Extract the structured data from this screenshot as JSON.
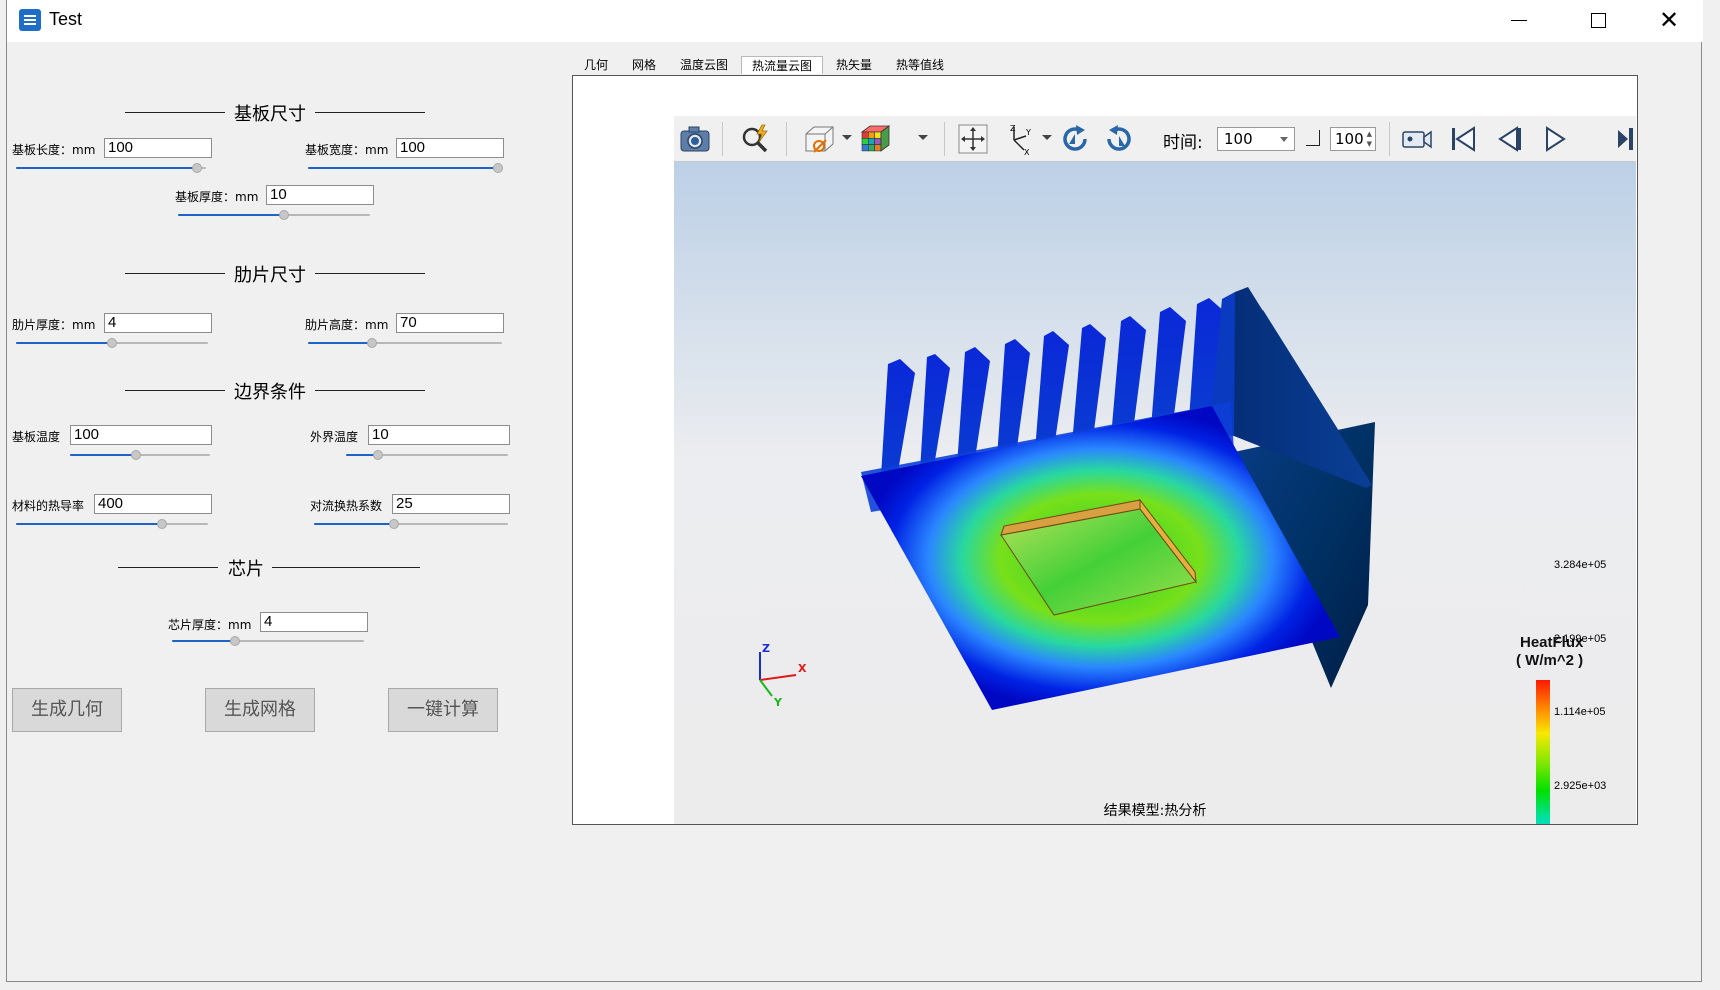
{
  "window": {
    "title": "Test",
    "close_glyph": "✕"
  },
  "sections": {
    "substrate": "基板尺寸",
    "fin": "肋片尺寸",
    "boundary": "边界条件",
    "chip": "芯片"
  },
  "fields": {
    "substrate_length": {
      "label": "基板长度：mm",
      "value": "100",
      "level": 0.95
    },
    "substrate_width": {
      "label": "基板宽度：mm",
      "value": "100",
      "level": 0.99
    },
    "substrate_thickness": {
      "label": "基板厚度：mm",
      "value": "10",
      "level": 0.55
    },
    "fin_thickness": {
      "label": "肋片厚度：mm",
      "value": "4",
      "level": 0.5
    },
    "fin_height": {
      "label": "肋片高度：mm",
      "value": "70",
      "level": 0.33
    },
    "substrate_temp": {
      "label": "基板温度",
      "value": "100",
      "level": 0.47
    },
    "ambient_temp": {
      "label": "外界温度",
      "value": "10",
      "level": 0.2
    },
    "conductivity": {
      "label": "材料的热导率",
      "value": "400",
      "level": 0.76
    },
    "convection": {
      "label": "对流换热系数",
      "value": "25",
      "level": 0.41
    },
    "chip_thickness": {
      "label": "芯片厚度：mm",
      "value": "4",
      "level": 0.33
    }
  },
  "buttons": {
    "gen_geometry": "生成几何",
    "gen_mesh": "生成网格",
    "one_click": "一键计算"
  },
  "tabs": [
    "几何",
    "网格",
    "温度云图",
    "热流量云图",
    "热矢量",
    "热等值线"
  ],
  "active_tab": "热流量云图",
  "toolbar": {
    "time_label": "时间:",
    "time_value": "100",
    "step_value": "100",
    "icons": [
      "camera-icon",
      "zoom-icon",
      "section-view-icon",
      "color-cube-icon",
      "pan-icon",
      "axes-icon",
      "rotate-cw-icon",
      "rotate-ccw-icon",
      "record-icon",
      "first-frame-icon",
      "prev-frame-icon",
      "play-icon",
      "last-frame-icon"
    ]
  },
  "view": {
    "result_label": "结果模型:热分析",
    "axes": {
      "x": "X",
      "y": "Y",
      "z": "Z"
    }
  },
  "legend": {
    "title": "HeatFlux",
    "unit": "( W/m^2 )",
    "max": "3.284e+05",
    "tick2": "2.199e+05",
    "tick3": "1.114e+05",
    "min": "2.925e+03"
  },
  "colors": {
    "accent": "#1e64c8",
    "heat_low": "#0000e0",
    "heat_high": "#ff2000"
  }
}
